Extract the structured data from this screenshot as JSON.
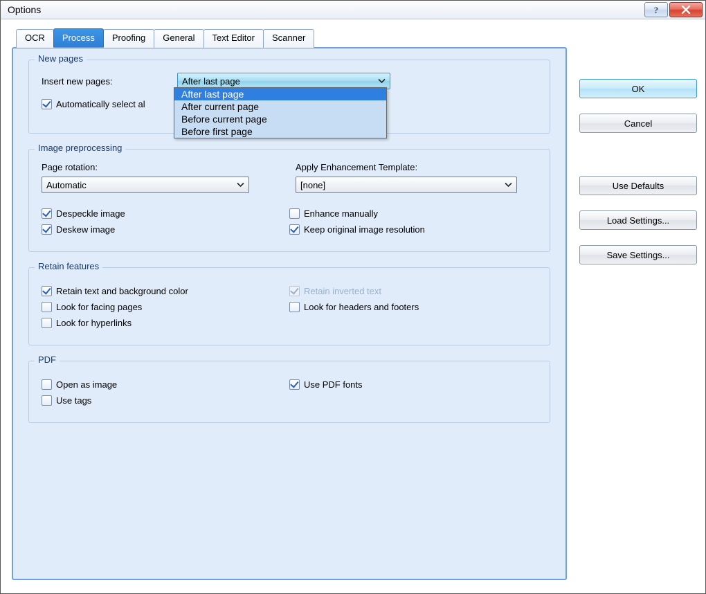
{
  "window": {
    "title": "Options"
  },
  "tabs": {
    "items": [
      "OCR",
      "Process",
      "Proofing",
      "General",
      "Text Editor",
      "Scanner"
    ],
    "active": "Process"
  },
  "newpages": {
    "group_title": "New pages",
    "insert_label": "Insert new pages:",
    "insert_value": "After last page",
    "options": [
      "After last page",
      "After current page",
      "Before current page",
      "Before first page"
    ],
    "selected_option": "After last page",
    "auto_select_label": "Automatically select al"
  },
  "imgprep": {
    "group_title": "Image preprocessing",
    "rotation_label": "Page rotation:",
    "rotation_value": "Automatic",
    "enhance_template_label": "Apply Enhancement Template:",
    "enhance_template_value": "[none]",
    "despeckle": "Despeckle image",
    "deskew": "Deskew image",
    "enhance_manually": "Enhance manually",
    "keep_res": "Keep original image resolution"
  },
  "retain": {
    "group_title": "Retain features",
    "text_bg": "Retain text and background color",
    "inverted": "Retain inverted text",
    "facing": "Look for facing pages",
    "headers": "Look for headers and footers",
    "hyperlinks": "Look for hyperlinks"
  },
  "pdf": {
    "group_title": "PDF",
    "open_as_image": "Open as image",
    "use_tags": "Use tags",
    "use_pdf_fonts": "Use PDF fonts"
  },
  "buttons": {
    "ok": "OK",
    "cancel": "Cancel",
    "defaults": "Use Defaults",
    "load": "Load Settings...",
    "save": "Save Settings..."
  }
}
